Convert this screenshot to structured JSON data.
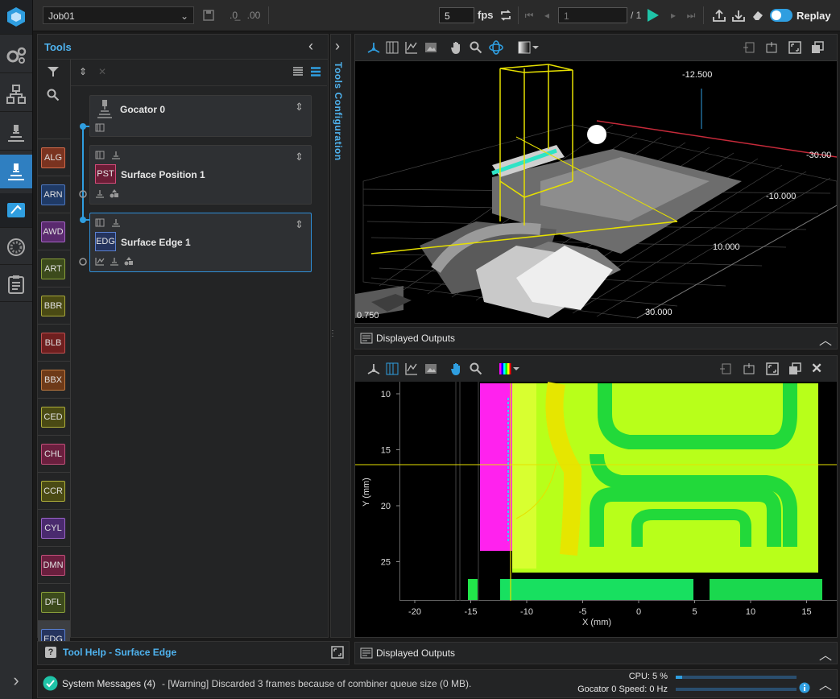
{
  "rail": {
    "items": [
      {
        "name": "logo-icon"
      },
      {
        "name": "settings-gears-icon"
      },
      {
        "name": "network-icon"
      },
      {
        "name": "scan-icon"
      },
      {
        "name": "measure-icon"
      },
      {
        "name": "output-icon"
      },
      {
        "name": "dashboard-icon"
      },
      {
        "name": "report-icon"
      }
    ],
    "collapse_glyph": "›"
  },
  "toolbar": {
    "job": "Job01",
    "fps_value": "5",
    "fps_label": "fps",
    "frame_value": "1",
    "frame_total": "/ 1",
    "replay_label": "Replay",
    "accent": "#2f9ee0"
  },
  "tools_panel": {
    "title": "Tools",
    "categories": [
      "ALG",
      "ARN",
      "AWD",
      "ART",
      "BBR",
      "BLB",
      "BBX",
      "CED",
      "CHL",
      "CCR",
      "CYL",
      "DMN",
      "DFL",
      "EDG"
    ],
    "cards": [
      {
        "name": "Gocator 0"
      },
      {
        "badge": "PST",
        "name": "Surface Position 1"
      },
      {
        "badge": "EDG",
        "name": "Surface Edge 1"
      }
    ],
    "help_label": "Tool Help - Surface Edge"
  },
  "config_tab": {
    "label": "Tools Configuration"
  },
  "viewer3d": {
    "labels": [
      "-12.500",
      "-30.00",
      "-10.000",
      "10.000",
      "30.000",
      "0.750"
    ],
    "outputs_label": "Displayed Outputs"
  },
  "viewer2d": {
    "y_ticks": [
      "10",
      "15",
      "20",
      "25"
    ],
    "x_ticks": [
      "-20",
      "-15",
      "-10",
      "-5",
      "0",
      "5",
      "10",
      "15"
    ],
    "ylabel": "Y (mm)",
    "xlabel": "X (mm)",
    "outputs_label": "Displayed Outputs"
  },
  "status": {
    "messages_label": "System Messages (4)",
    "message_text": "- [Warning] Discarded 3 frames because of combiner queue size (0 MB).",
    "cpu_label": "CPU: 5 %",
    "speed_label": "Gocator 0 Speed: 0 Hz",
    "cpu_fraction": 0.05,
    "speed_fraction": 0
  }
}
